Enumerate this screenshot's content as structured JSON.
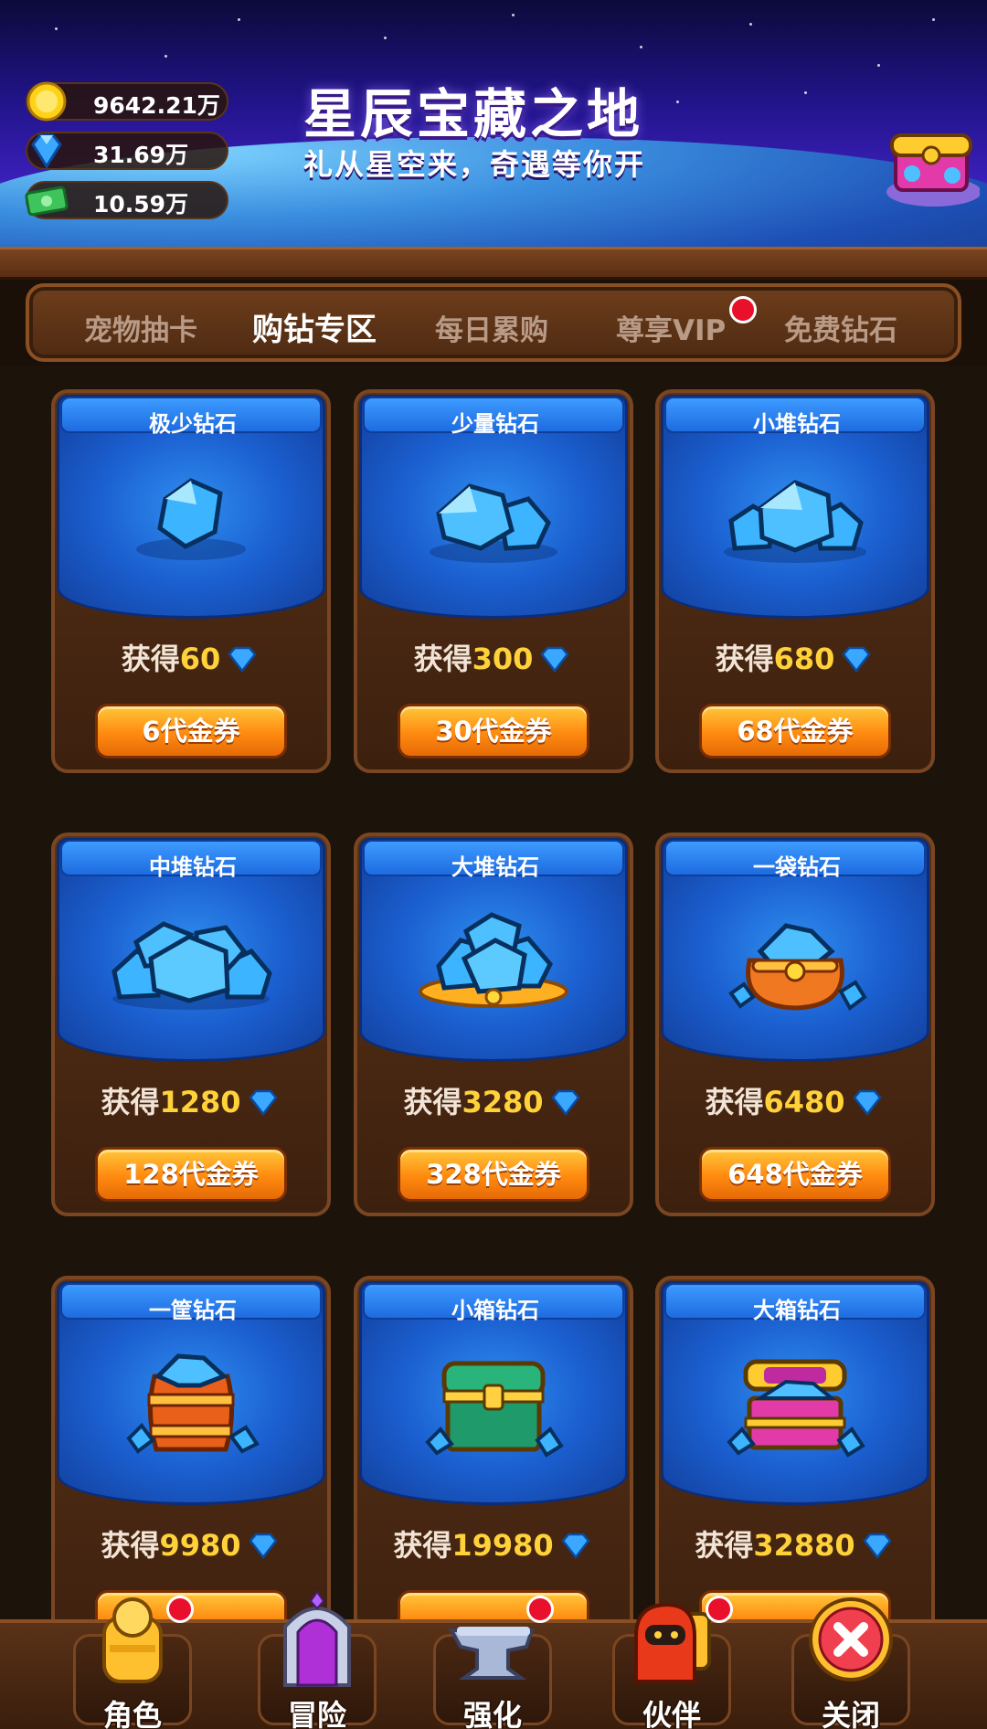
{
  "banner": {
    "title": "星辰宝藏之地",
    "subtitle": "礼从星空来，奇遇等你开"
  },
  "currencies": [
    {
      "icon": "gold-coin-icon",
      "value": "9642.21万"
    },
    {
      "icon": "diamond-icon",
      "value": "31.69万"
    },
    {
      "icon": "cash-icon",
      "value": "10.59万"
    }
  ],
  "tabs": [
    {
      "label": "宠物抽卡",
      "active": false
    },
    {
      "label": "购钻专区",
      "active": true
    },
    {
      "label": "每日累购",
      "active": false
    },
    {
      "label": "尊享VIP",
      "active": false,
      "badge": true
    },
    {
      "label": "免费钻石",
      "active": false
    }
  ],
  "gain_prefix": "获得",
  "cards": [
    {
      "title": "极少钻石",
      "amount": "60",
      "price": "6代金券",
      "icon": "small-gem-icon"
    },
    {
      "title": "少量钻石",
      "amount": "300",
      "price": "30代金券",
      "icon": "two-gems-icon"
    },
    {
      "title": "小堆钻石",
      "amount": "680",
      "price": "68代金券",
      "icon": "gem-pile-small-icon"
    },
    {
      "title": "中堆钻石",
      "amount": "1280",
      "price": "128代金券",
      "icon": "gem-pile-medium-icon"
    },
    {
      "title": "大堆钻石",
      "amount": "3280",
      "price": "328代金券",
      "icon": "gem-pile-large-icon"
    },
    {
      "title": "一袋钻石",
      "amount": "6480",
      "price": "648代金券",
      "icon": "gem-bag-icon"
    },
    {
      "title": "一筐钻石",
      "amount": "9980",
      "price": "",
      "icon": "gem-barrel-icon"
    },
    {
      "title": "小箱钻石",
      "amount": "19980",
      "price": "",
      "icon": "gem-chest-green-icon"
    },
    {
      "title": "大箱钻石",
      "amount": "32880",
      "price": "",
      "icon": "gem-chest-purple-icon"
    }
  ],
  "bottom_nav": [
    {
      "label": "角色",
      "icon": "character-icon",
      "badge": true
    },
    {
      "label": "冒险",
      "icon": "portal-icon",
      "badge": false
    },
    {
      "label": "强化",
      "icon": "anvil-icon",
      "badge": true
    },
    {
      "label": "伙伴",
      "icon": "partner-icon",
      "badge": true
    },
    {
      "label": "关闭",
      "icon": "close-icon",
      "badge": false
    }
  ],
  "colors": {
    "accent_gold": "#ffd23a",
    "button_orange": "#ff8a10",
    "card_blue": "#1b5fd0",
    "wood": "#5a3218",
    "badge_red": "#e8102a"
  }
}
